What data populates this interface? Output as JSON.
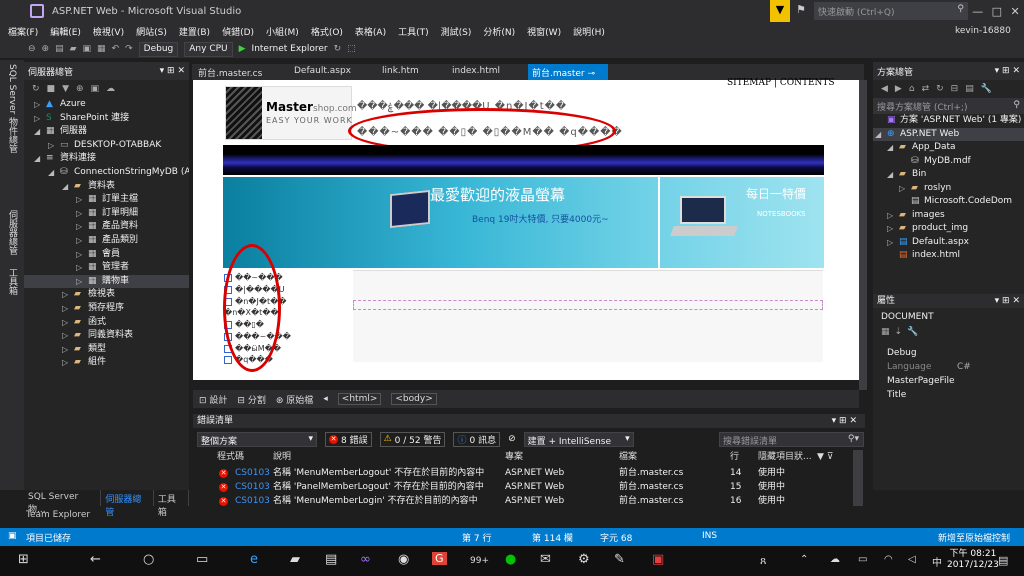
{
  "window": {
    "title": "ASP.NET Web - Microsoft Visual Studio",
    "quick_launch_placeholder": "快速啟動 (Ctrl+Q)",
    "user": "kevin-16880"
  },
  "menu": [
    "檔案(F)",
    "編輯(E)",
    "檢視(V)",
    "網站(S)",
    "建置(B)",
    "偵錯(D)",
    "小組(M)",
    "格式(O)",
    "表格(A)",
    "工具(T)",
    "測試(S)",
    "分析(N)",
    "視窗(W)",
    "說明(H)"
  ],
  "toolbar": {
    "config": "Debug",
    "platform": "Any CPU",
    "run_target": "Internet Explorer"
  },
  "left_vertical_tabs": [
    "SQL Server 物件總管",
    "伺服器總管",
    "工具箱"
  ],
  "server_explorer": {
    "title": "伺服器總管",
    "tree": [
      {
        "label": "Azure",
        "level": 0,
        "icon": "azure-icon",
        "expander": "▷"
      },
      {
        "label": "SharePoint 連接",
        "level": 0,
        "icon": "sharepoint-icon",
        "expander": "▷"
      },
      {
        "label": "伺服器",
        "level": 0,
        "icon": "server-icon",
        "expander": "◢"
      },
      {
        "label": "DESKTOP-OTABBAK",
        "level": 1,
        "icon": "computer-icon",
        "expander": "▷"
      },
      {
        "label": "資料連接",
        "level": 0,
        "icon": "data-connection-icon",
        "expander": "◢"
      },
      {
        "label": "ConnectionStringMyDB (A",
        "level": 1,
        "icon": "database-icon",
        "expander": "◢"
      },
      {
        "label": "資料表",
        "level": 2,
        "icon": "folder-icon",
        "expander": "◢"
      },
      {
        "label": "訂單主檔",
        "level": 3,
        "icon": "table-icon",
        "expander": "▷"
      },
      {
        "label": "訂單明細",
        "level": 3,
        "icon": "table-icon",
        "expander": "▷"
      },
      {
        "label": "產品資料",
        "level": 3,
        "icon": "table-icon",
        "expander": "▷"
      },
      {
        "label": "產品類別",
        "level": 3,
        "icon": "table-icon",
        "expander": "▷"
      },
      {
        "label": "會員",
        "level": 3,
        "icon": "table-icon",
        "expander": "▷"
      },
      {
        "label": "管理者",
        "level": 3,
        "icon": "table-icon",
        "expander": "▷"
      },
      {
        "label": "購物車",
        "level": 3,
        "icon": "table-icon",
        "expander": "▷",
        "selected": true
      },
      {
        "label": "檢視表",
        "level": 2,
        "icon": "folder-icon",
        "expander": "▷"
      },
      {
        "label": "預存程序",
        "level": 2,
        "icon": "folder-icon",
        "expander": "▷"
      },
      {
        "label": "函式",
        "level": 2,
        "icon": "folder-icon",
        "expander": "▷"
      },
      {
        "label": "同義資料表",
        "level": 2,
        "icon": "folder-icon",
        "expander": "▷"
      },
      {
        "label": "類型",
        "level": 2,
        "icon": "folder-icon",
        "expander": "▷"
      },
      {
        "label": "組件",
        "level": 2,
        "icon": "folder-icon",
        "expander": "▷"
      }
    ],
    "bottom_tabs": [
      "SQL Server 物...",
      "伺服器總管",
      "工具箱"
    ],
    "team_explorer": "Team Explorer"
  },
  "editor_tabs": [
    {
      "label": "前台.master.cs",
      "active": false
    },
    {
      "label": "Default.aspx",
      "active": false
    },
    {
      "label": "link.htm",
      "active": false
    },
    {
      "label": "index.html",
      "active": false
    },
    {
      "label": "前台.master",
      "active": true
    }
  ],
  "design": {
    "sitemap": "SITEMAP | CONTENTS",
    "logo_main": "Master",
    "logo_domain": "shop.com",
    "logo_sub": "EASY YOUR WORK",
    "garbled_1": "���ۼ��� �|����U �n�J�t��",
    "garbled_2": "���~��� ��▯� �▯��M�� �q����",
    "banner_title": "最愛歡迎的液晶螢幕",
    "banner_sub": "Benq 19吋大特價, 只要4000元~",
    "banner_daily": "每日一特價",
    "banner_note": "NOTESBOOKS",
    "side_items": [
      "��~���",
      "�|����U",
      "�n�J�t��",
      "�n�X�t��",
      "��▯�",
      "���~���",
      "��ӹM��",
      "�q���"
    ]
  },
  "view_bar": {
    "design": "設計",
    "split": "分割",
    "source": "原始檔",
    "crumb1": "<html>",
    "crumb2": "<body>"
  },
  "error_list": {
    "title": "錯誤清單",
    "scope": "整個方案",
    "errors_btn": "8 錯誤",
    "warnings_btn": "0 / 52 警告",
    "messages_btn": "0 訊息",
    "build_filter": "建置 + IntelliSense",
    "search_placeholder": "搜尋錯誤清單",
    "headers": [
      "程式碼",
      "說明",
      "專案",
      "檔案",
      "行",
      "隱藏項目狀..."
    ],
    "rows": [
      {
        "code": "CS0103",
        "desc": "名稱 'MenuMemberLogout' 不存在於目前的內容中",
        "project": "ASP.NET Web",
        "file": "前台.master.cs",
        "line": "14",
        "state": "使用中"
      },
      {
        "code": "CS0103",
        "desc": "名稱 'PanelMemberLogout' 不存在於目前的內容中",
        "project": "ASP.NET Web",
        "file": "前台.master.cs",
        "line": "15",
        "state": "使用中"
      },
      {
        "code": "CS0103",
        "desc": "名稱 'MenuMemberLogin' 不存在於目前的內容中",
        "project": "ASP.NET Web",
        "file": "前台.master.cs",
        "line": "16",
        "state": "使用中"
      }
    ]
  },
  "solution_explorer": {
    "title": "方案總管",
    "search_placeholder": "搜尋方案總管 (Ctrl+;)",
    "items": [
      {
        "label": "方案 'ASP.NET Web' (1 專案)",
        "level": 0,
        "icon": "solution-icon",
        "expander": ""
      },
      {
        "label": "ASP.NET Web",
        "level": 0,
        "icon": "website-icon",
        "expander": "◢",
        "selected": true
      },
      {
        "label": "App_Data",
        "level": 1,
        "icon": "folder-icon",
        "expander": "◢"
      },
      {
        "label": "MyDB.mdf",
        "level": 2,
        "icon": "database-icon",
        "expander": ""
      },
      {
        "label": "Bin",
        "level": 1,
        "icon": "folder-icon",
        "expander": "◢"
      },
      {
        "label": "roslyn",
        "level": 2,
        "icon": "folder-icon",
        "expander": "▷"
      },
      {
        "label": "Microsoft.CodeDom",
        "level": 2,
        "icon": "file-icon",
        "expander": ""
      },
      {
        "label": "images",
        "level": 1,
        "icon": "folder-icon",
        "expander": "▷"
      },
      {
        "label": "product_img",
        "level": 1,
        "icon": "folder-icon",
        "expander": "▷"
      },
      {
        "label": "Default.aspx",
        "level": 1,
        "icon": "aspx-icon",
        "expander": "▷"
      },
      {
        "label": "index.html",
        "level": 1,
        "icon": "html-icon",
        "expander": ""
      }
    ]
  },
  "properties": {
    "title": "屬性",
    "object": "DOCUMENT",
    "rows": [
      {
        "name": "Debug",
        "value": ""
      },
      {
        "name": "Language",
        "value": "C#"
      },
      {
        "name": "MasterPageFile",
        "value": ""
      },
      {
        "name": "Title",
        "value": ""
      }
    ]
  },
  "status": {
    "left": "項目已儲存",
    "line": "第 7 行",
    "col": "第 114 欄",
    "char": "字元 68",
    "ins": "INS",
    "right": "新增至原始檔控制"
  },
  "taskbar": {
    "time": "下午 08:21",
    "date": "2017/12/23",
    "ime": "中",
    "badge": "99+"
  }
}
